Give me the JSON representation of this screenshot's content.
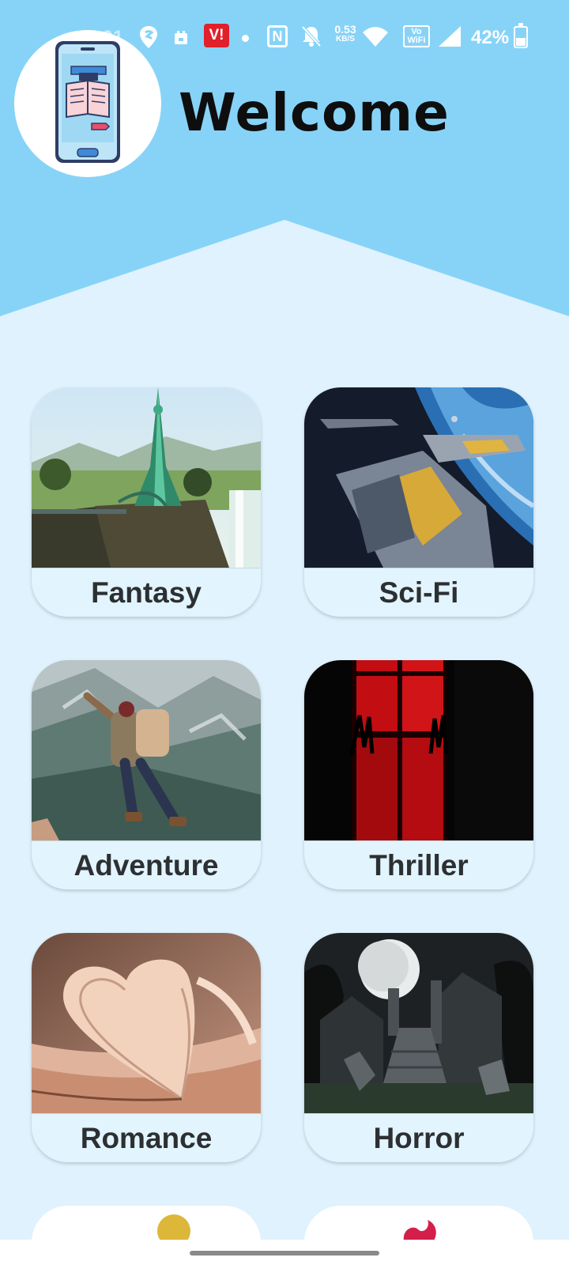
{
  "status_bar": {
    "time": "7:01",
    "vi_badge": "V!",
    "nfc": "N",
    "net_speed_value": "0.53",
    "net_speed_unit": "KB/S",
    "vowifi_top": "Vo",
    "vowifi_bottom": "WiFi",
    "battery_text": "42%",
    "battery_level": 0.42
  },
  "header": {
    "title": "Welcome",
    "avatar_icon": "ebook-reader-phone-icon",
    "background_color": "#87d3f8"
  },
  "genres": [
    {
      "label": "Fantasy",
      "image": "fantasy-island-tower-image"
    },
    {
      "label": "Sci-Fi",
      "image": "spaceships-over-planet-image"
    },
    {
      "label": "Adventure",
      "image": "hiker-jumping-mountains-image"
    },
    {
      "label": "Thriller",
      "image": "red-window-silhouette-image"
    },
    {
      "label": "Romance",
      "image": "heart-shaped-book-pages-image"
    },
    {
      "label": "Horror",
      "image": "moonlit-graveyard-image"
    }
  ],
  "colors": {
    "page_background": "#dff2fd",
    "card_label_band": "#e2f4fd",
    "label_text": "#2c3033"
  }
}
